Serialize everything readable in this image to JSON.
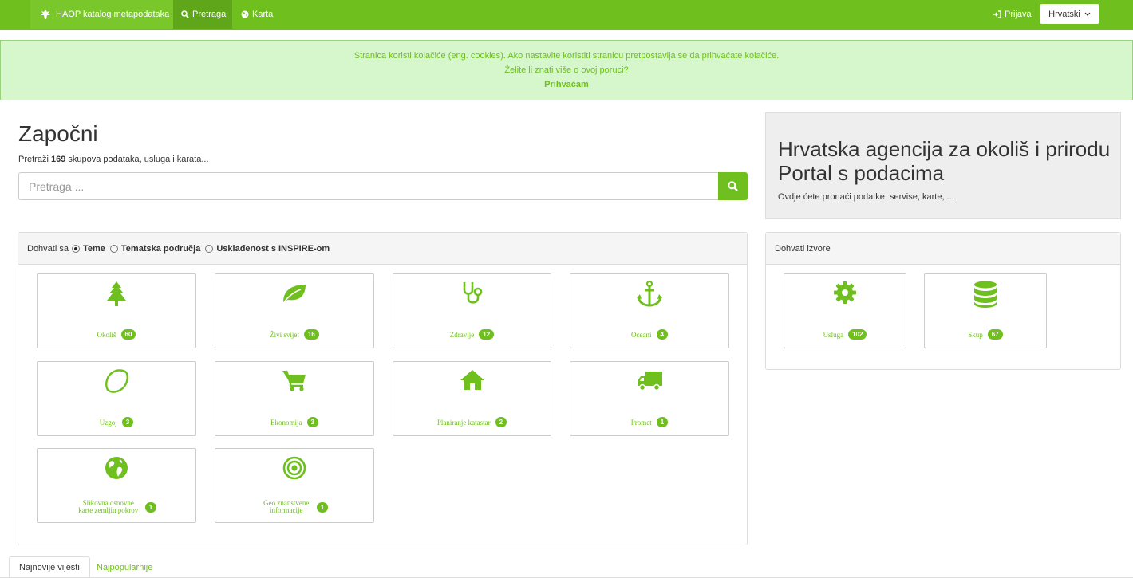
{
  "navbar": {
    "brand": "HAOP katalog metapodataka",
    "search": "Pretraga",
    "map": "Karta",
    "login": "Prijava",
    "language": "Hrvatski"
  },
  "cookie": {
    "line1": "Stranica koristi kolačiće (eng. cookies). Ako nastavite koristiti stranicu pretpostavlja se da prihvaćate kolačiće.",
    "line2": "Želite li znati više o ovoj poruci?",
    "accept": "Prihvaćam"
  },
  "intro": {
    "title": "Započni",
    "count_prefix": "Pretraži",
    "count": "169",
    "count_suffix": "skupova podataka, usluga i karata...",
    "search_placeholder": "Pretraga ..."
  },
  "hero": {
    "title": "Hrvatska agencija za okoliš i prirodu Portal s podacima",
    "subtitle": "Ovdje ćete pronaći podatke, servise, karte, ..."
  },
  "topics_panel": {
    "label": "Dohvati sa",
    "options": [
      "Teme",
      "Tematska područja",
      "Usklađenost s INSPIRE-om"
    ],
    "selected": "Teme",
    "tiles": [
      {
        "icon": "tree-icon",
        "label": "Okoliš",
        "count": "60"
      },
      {
        "icon": "leaf-icon",
        "label": "Živi svijet",
        "count": "16"
      },
      {
        "icon": "stethoscope-icon",
        "label": "Zdravlje",
        "count": "12"
      },
      {
        "icon": "anchor-icon",
        "label": "Oceani",
        "count": "4"
      },
      {
        "icon": "lemon-icon",
        "label": "Uzgoj",
        "count": "3"
      },
      {
        "icon": "cart-icon",
        "label": "Ekonomija",
        "count": "3"
      },
      {
        "icon": "home-icon",
        "label": "Planiranje katastar",
        "count": "2"
      },
      {
        "icon": "truck-icon",
        "label": "Promet",
        "count": "1"
      },
      {
        "icon": "globe-icon",
        "label": "Slikovna osnovne karte zemljin pokrov",
        "count": "1"
      },
      {
        "icon": "bullseye-icon",
        "label": "Geo znanstvene informacije",
        "count": "1"
      }
    ]
  },
  "sources_panel": {
    "label": "Dohvati izvore",
    "tiles": [
      {
        "icon": "gear-icon",
        "label": "Usluga",
        "count": "102"
      },
      {
        "icon": "database-icon",
        "label": "Skup",
        "count": "67"
      }
    ]
  },
  "tabs": [
    "Najnovije vijesti",
    "Najpopularnije"
  ],
  "colors": {
    "brand_green": "#6fbf1f",
    "cookie_bg": "#d6f6cc"
  }
}
